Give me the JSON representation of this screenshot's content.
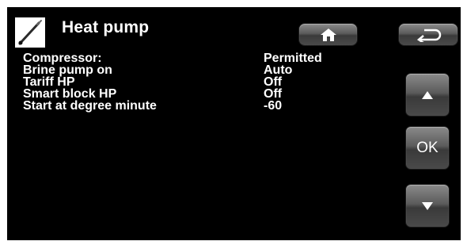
{
  "header": {
    "title": "Heat pump",
    "icon": "pen-icon"
  },
  "nav": {
    "home_icon": "home-icon",
    "back_icon": "back-arrow-icon",
    "up_icon": "up-arrow-icon",
    "ok_label": "OK",
    "down_icon": "down-arrow-icon"
  },
  "params": [
    {
      "label": "Compressor:",
      "value": "Permitted"
    },
    {
      "label": "Brine pump on",
      "value": "Auto"
    },
    {
      "label": "Tariff HP",
      "value": "Off"
    },
    {
      "label": "Smart block HP",
      "value": "Off"
    },
    {
      "label": "Start at degree minute",
      "value": "-60"
    }
  ],
  "colors": {
    "screen_bg": "#000000",
    "text": "#ffffff",
    "button": "#5c5c5c"
  }
}
